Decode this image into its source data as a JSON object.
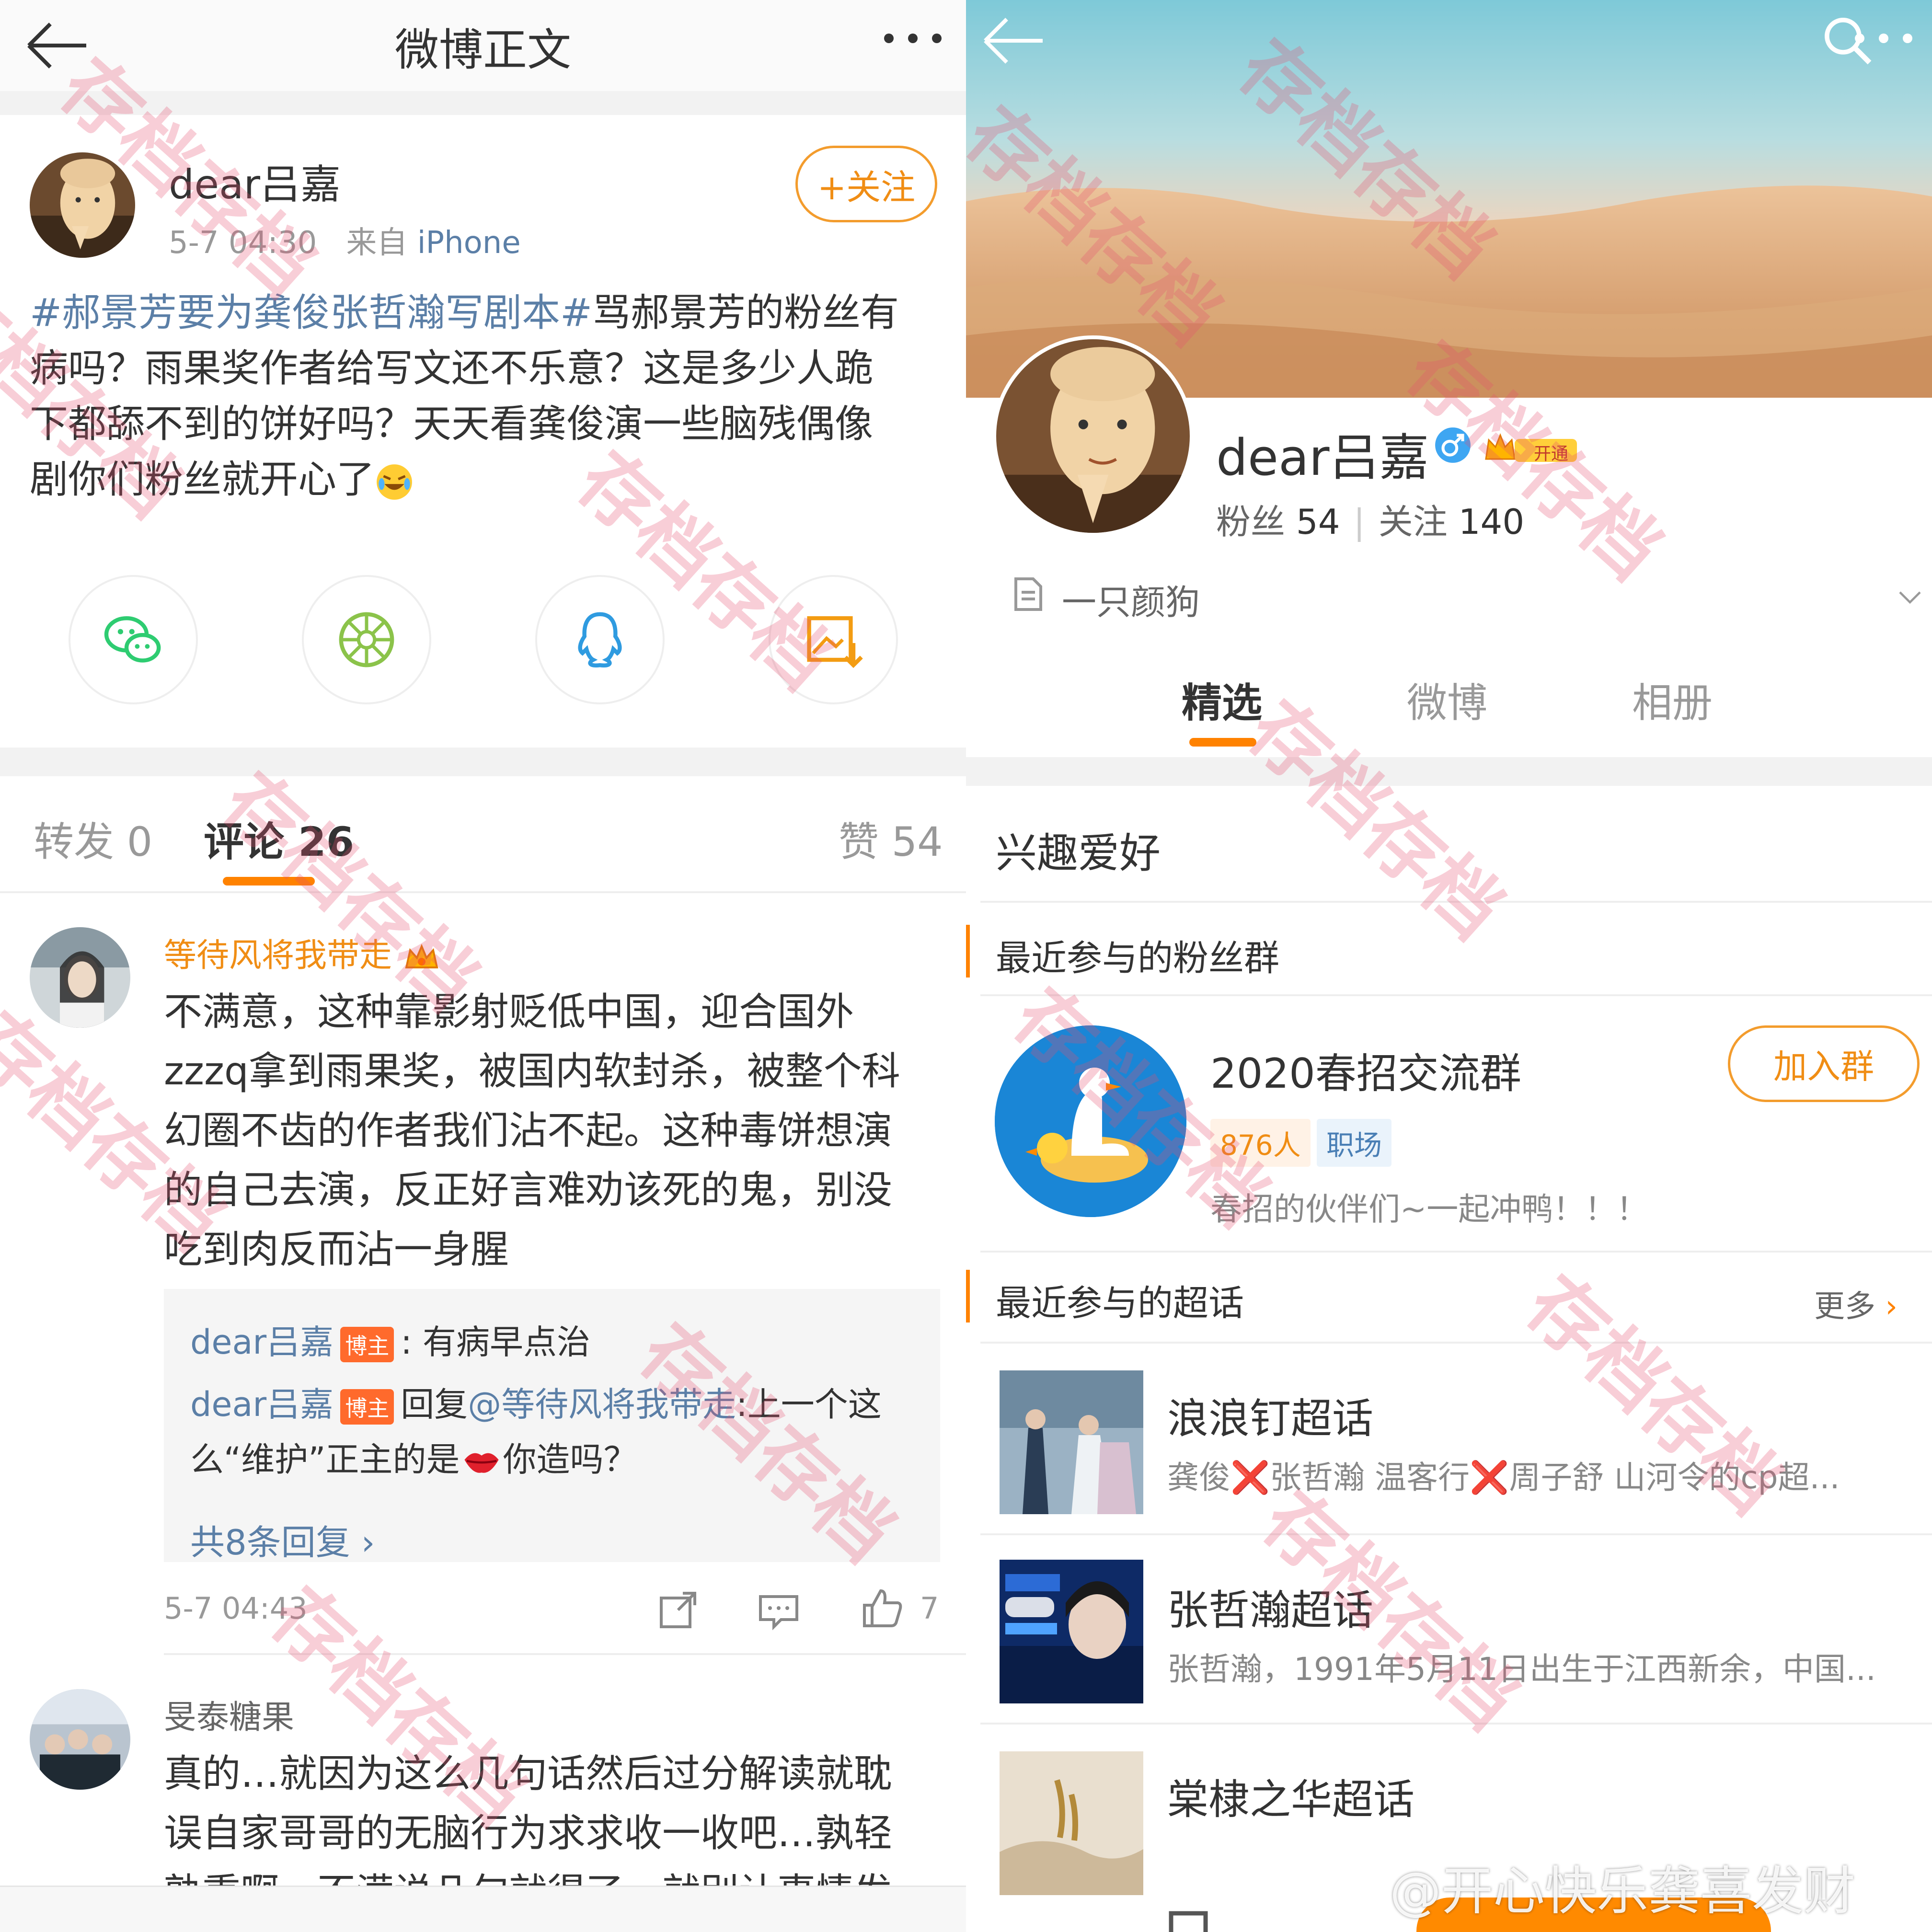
{
  "left": {
    "header": {
      "title": "微博正文"
    },
    "post": {
      "author": "dear吕嘉",
      "time": "5-7 04:30",
      "source_prefix": "来自",
      "source": "iPhone",
      "follow_label": "+关注",
      "topic": "#郝景芳要为龚俊张哲瀚写剧本#",
      "lines": [
        "骂郝景芳的粉丝有",
        "病吗？雨果奖作者给写文还不乐意？这是多少人跪",
        "下都舔不到的饼好吗？天天看龚俊演一些脑残偶像",
        "剧你们粉丝就开心了"
      ]
    },
    "share_icons": [
      "wechat-icon",
      "moments-icon",
      "qq-icon",
      "save-image-icon"
    ],
    "tabs": {
      "repost": "转发 0",
      "comments": "评论 26",
      "likes": "赞 54"
    },
    "comments": [
      {
        "name": "等待风将我带走",
        "lines": [
          "不满意，这种靠影射贬低中国，迎合国外",
          "zzzq拿到雨果奖，被国内软封杀，被整个科",
          "幻圈不齿的作者我们沾不起。这种毒饼想演",
          "的自己去演，反正好言难劝该死的鬼，别没",
          "吃到肉反而沾一身腥"
        ],
        "replies": [
          {
            "who": "dear吕嘉",
            "badge": "博主",
            "text": ": 有病早点治"
          },
          {
            "who": "dear吕嘉",
            "badge": "博主",
            "reply_word": "回复",
            "at": "@等待风将我带走",
            "text": ":上一个这"
          }
        ],
        "reply_line3": "么“维护”正主的是",
        "reply_line3_end": "你造吗？",
        "more_replies": "共8条回复 ›",
        "time": "5-7 04:43",
        "like_count": "7"
      },
      {
        "name": "旻泰糖果",
        "lines": [
          "真的…就因为这么几句话然后过分解读就耽",
          "误自家哥哥的无脑行为求求收一收吧…孰轻",
          "孰重啊，不满说几句就得了，就别让事情发"
        ]
      }
    ]
  },
  "right": {
    "profile": {
      "name": "dear吕嘉",
      "vip_label": "开通",
      "fans_label": "粉丝",
      "fans": "54",
      "following_label": "关注",
      "following": "140",
      "bio": "一只颜狗"
    },
    "tabs": [
      "精选",
      "微博",
      "相册"
    ],
    "interests_title": "兴趣爱好",
    "fan_groups_title": "最近参与的粉丝群",
    "group": {
      "name": "2020春招交流群",
      "join_label": "加入群",
      "members": "876人",
      "category": "职场",
      "desc": "春招的伙伴们~一起冲鸭！！！"
    },
    "supertopics_title": "最近参与的超话",
    "more_label": "更多",
    "supertopics": [
      {
        "name": "浪浪钉超话",
        "desc": "龚俊❌张哲瀚 温客行❌周子舒 山河令的cp超..."
      },
      {
        "name": "张哲瀚超话",
        "desc": "张哲瀚，1991年5月11日出生于江西新余，中国..."
      },
      {
        "name": "棠棣之华超话",
        "desc": ""
      }
    ]
  },
  "watermark": "存档存档",
  "handle": "@开心快乐龚喜发财",
  "colors": {
    "accent": "#ff8200",
    "link": "#5b7fa7"
  }
}
